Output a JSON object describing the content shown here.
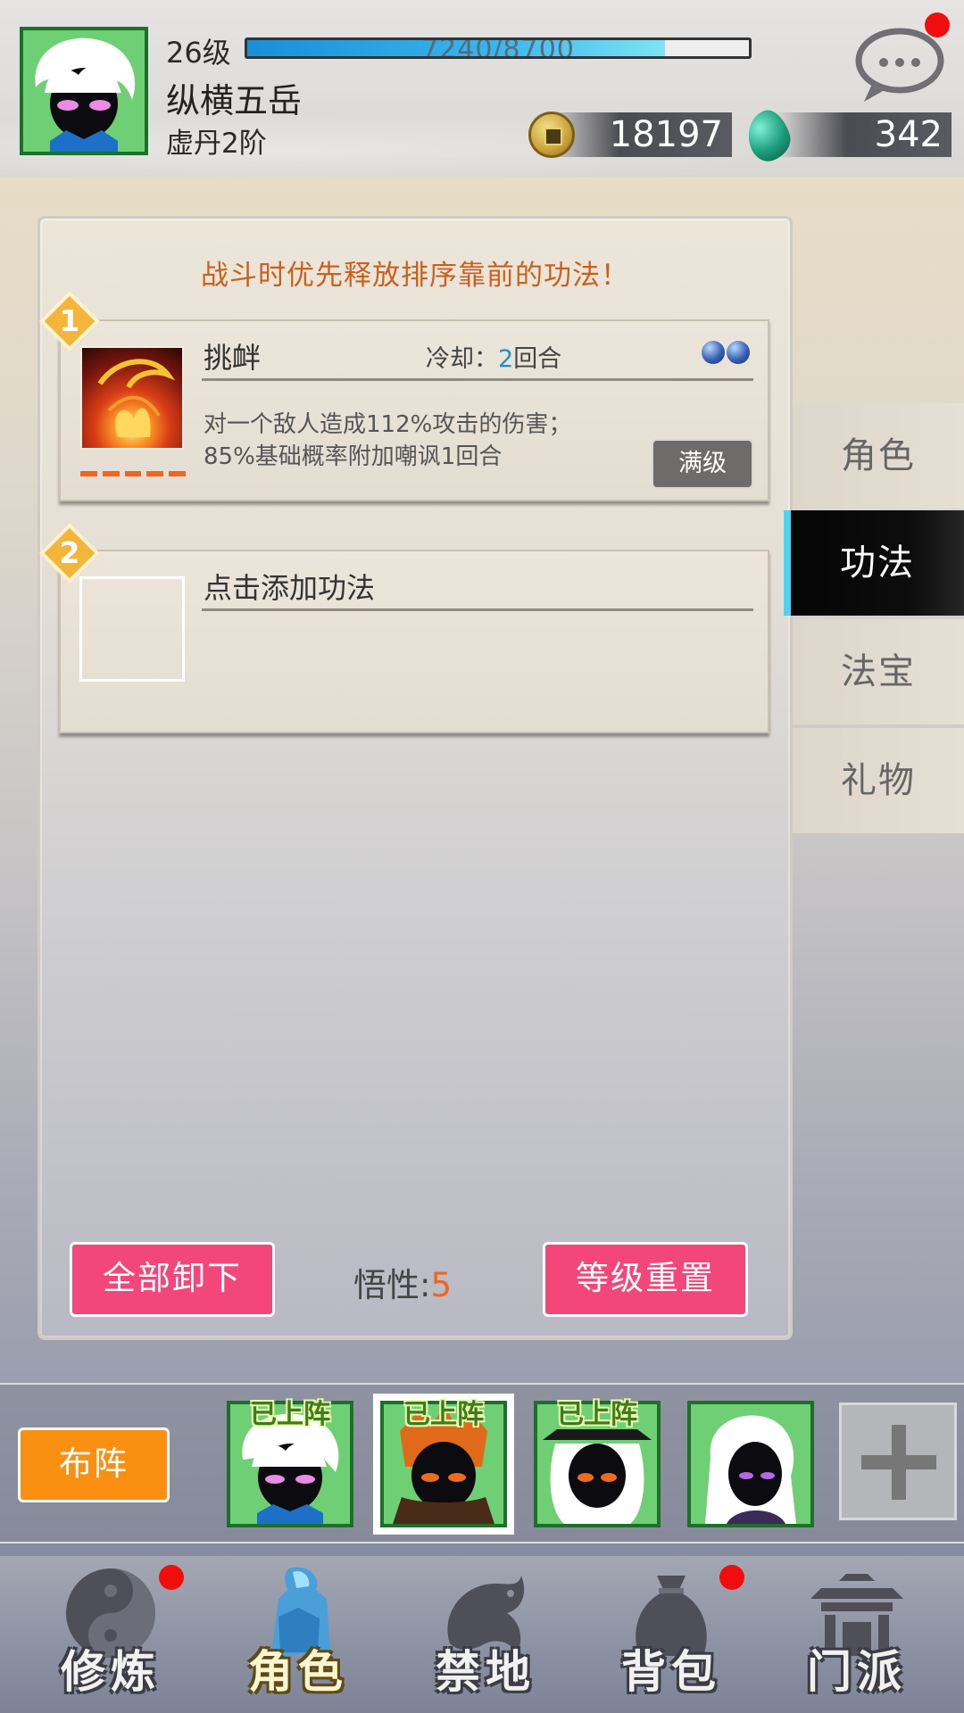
{
  "header": {
    "level": "26级",
    "exp_text": "7240/8700",
    "exp_fraction": 0.832,
    "player_name": "纵横五岳",
    "realm": "虚丹2阶",
    "gold": "18197",
    "jade": "342",
    "icons": {
      "avatar": "player-avatar",
      "gold": "coin-icon",
      "jade": "jade-icon",
      "chat": "chat-bubble-icon"
    }
  },
  "panel": {
    "hint": "战斗时优先释放排序靠前的功法！",
    "slots": [
      {
        "index": "1",
        "name": "挑衅",
        "cooldown_label": "冷却：",
        "cooldown_value": "2",
        "cooldown_unit": "回合",
        "desc_line1": "对一个敌人造成112%攻击的伤害；",
        "desc_line2": "85%基础概率附加嘲讽1回合",
        "max_label": "满级"
      },
      {
        "index": "2",
        "add_hint": "点击添加功法"
      }
    ],
    "unequip_all": "全部卸下",
    "comprehension_label": "悟性:",
    "comprehension_value": "5",
    "reset_level": "等级重置"
  },
  "side_tabs": [
    "角色",
    "功法",
    "法宝",
    "礼物"
  ],
  "active_side_tab": "功法",
  "team": {
    "formation": "布阵",
    "on_label": "已上阵",
    "heroes_on": [
      true,
      true,
      true,
      false
    ],
    "selected_index": 1
  },
  "bottom_nav": {
    "items": [
      "修炼",
      "角色",
      "禁地",
      "背包",
      "门派"
    ],
    "active": "角色",
    "badges": [
      true,
      false,
      false,
      true,
      false
    ]
  },
  "colors": {
    "accent_pink": "#f3467a",
    "accent_orange": "#fb8f11",
    "hint_orange": "#c9601d",
    "active_tab_bar": "#4fd2f0",
    "badge_red": "#f20d0d"
  }
}
